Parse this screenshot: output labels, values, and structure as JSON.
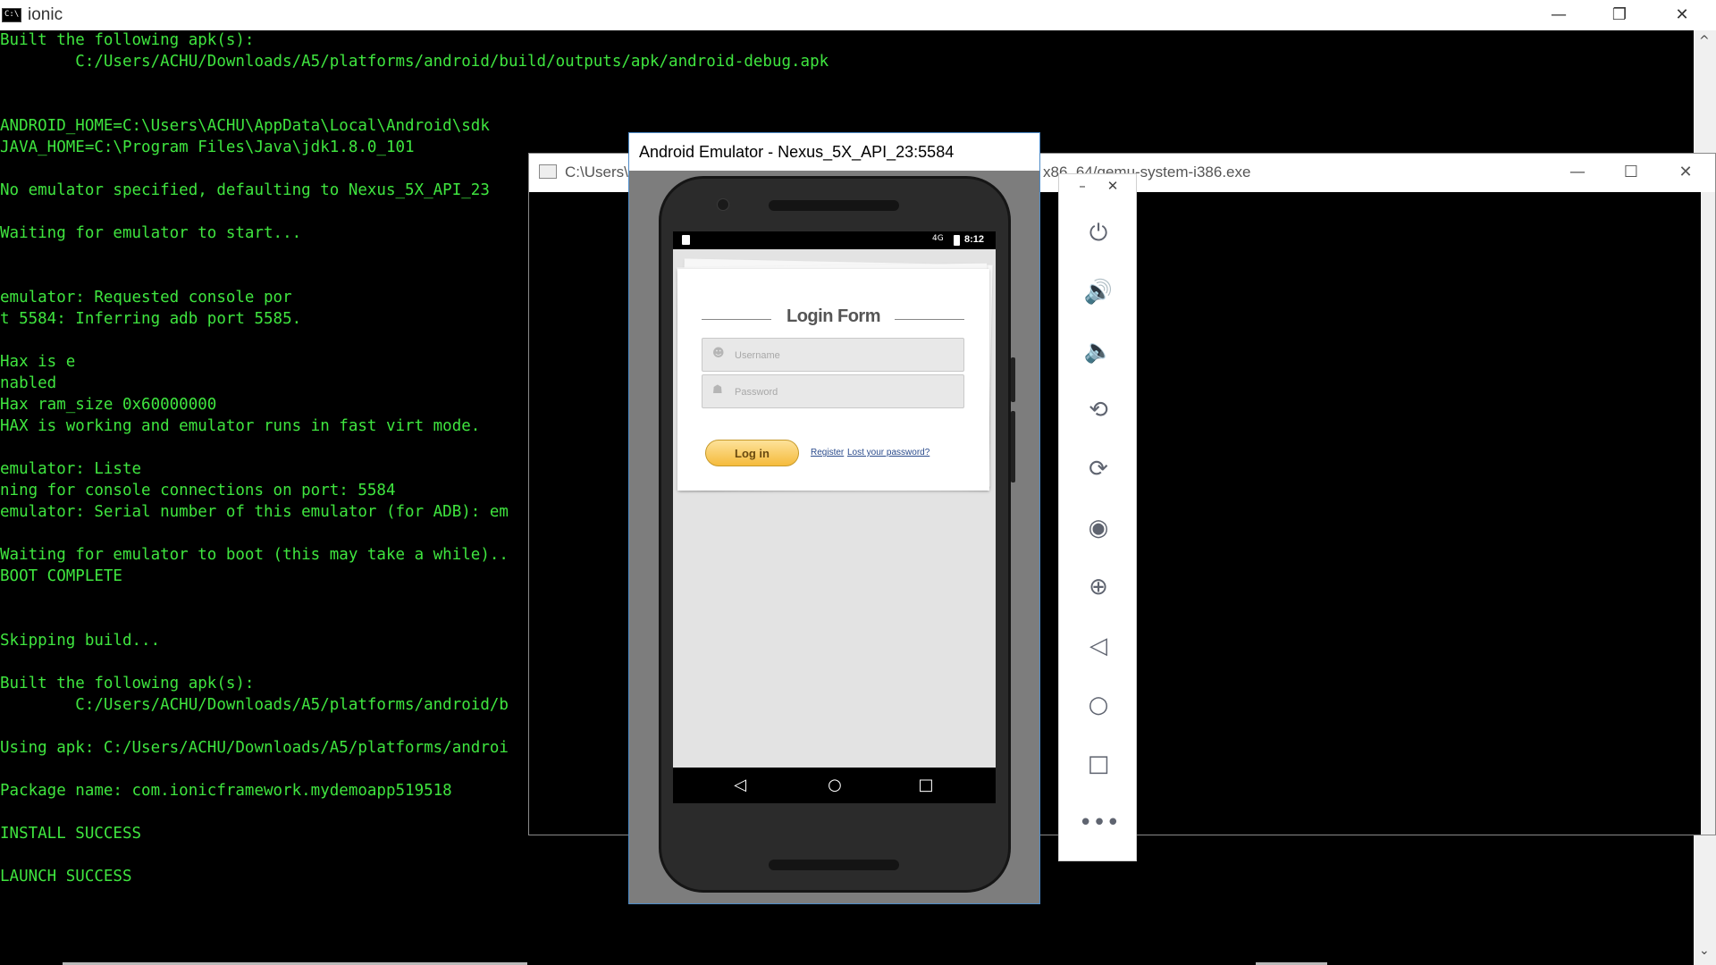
{
  "main_window": {
    "title": "ionic",
    "console_lines": [
      "Built the following apk(s):",
      "        C:/Users/ACHU/Downloads/A5/platforms/android/build/outputs/apk/android-debug.apk",
      "",
      "",
      "ANDROID_HOME=C:\\Users\\ACHU\\AppData\\Local\\Android\\sdk",
      "JAVA_HOME=C:\\Program Files\\Java\\jdk1.8.0_101",
      "",
      "No emulator specified, defaulting to Nexus_5X_API_23",
      "",
      "Waiting for emulator to start...",
      "",
      "",
      "emulator: Requested console por",
      "t 5584: Inferring adb port 5585.",
      "",
      "Hax is e",
      "nabled",
      "Hax ram_size 0x60000000",
      "HAX is working and emulator runs in fast virt mode.",
      "",
      "emulator: Liste",
      "ning for console connections on port: 5584",
      "emulator: Serial number of this emulator (for ADB): em",
      "",
      "Waiting for emulator to boot (this may take a while)..",
      "BOOT COMPLETE",
      "",
      "",
      "Skipping build...",
      "",
      "Built the following apk(s):",
      "        C:/Users/ACHU/Downloads/A5/platforms/android/b",
      "",
      "Using apk: C:/Users/ACHU/Downloads/A5/platforms/androi",
      "",
      "Package name: com.ionicframework.mydemoapp519518",
      "",
      "INSTALL SUCCESS",
      "",
      "LAUNCH SUCCESS"
    ]
  },
  "qemu_window": {
    "title_left": "C:\\Users\\",
    "title_right": "x86_64/qemu-system-i386.exe"
  },
  "emulator_window": {
    "title": "Android Emulator - Nexus_5X_API_23:5584"
  },
  "status_bar": {
    "network": "4G",
    "time": "8:12"
  },
  "login": {
    "title": "Login Form",
    "username_placeholder": "Username",
    "password_placeholder": "Password",
    "login_button": "Log in",
    "register_link": "Register",
    "lost_password_link": "Lost your password?"
  },
  "toolbar": {
    "items": [
      "power",
      "volume-up",
      "volume-down",
      "rotate-left",
      "rotate-right",
      "screenshot",
      "zoom",
      "back",
      "home",
      "overview",
      "more"
    ]
  }
}
